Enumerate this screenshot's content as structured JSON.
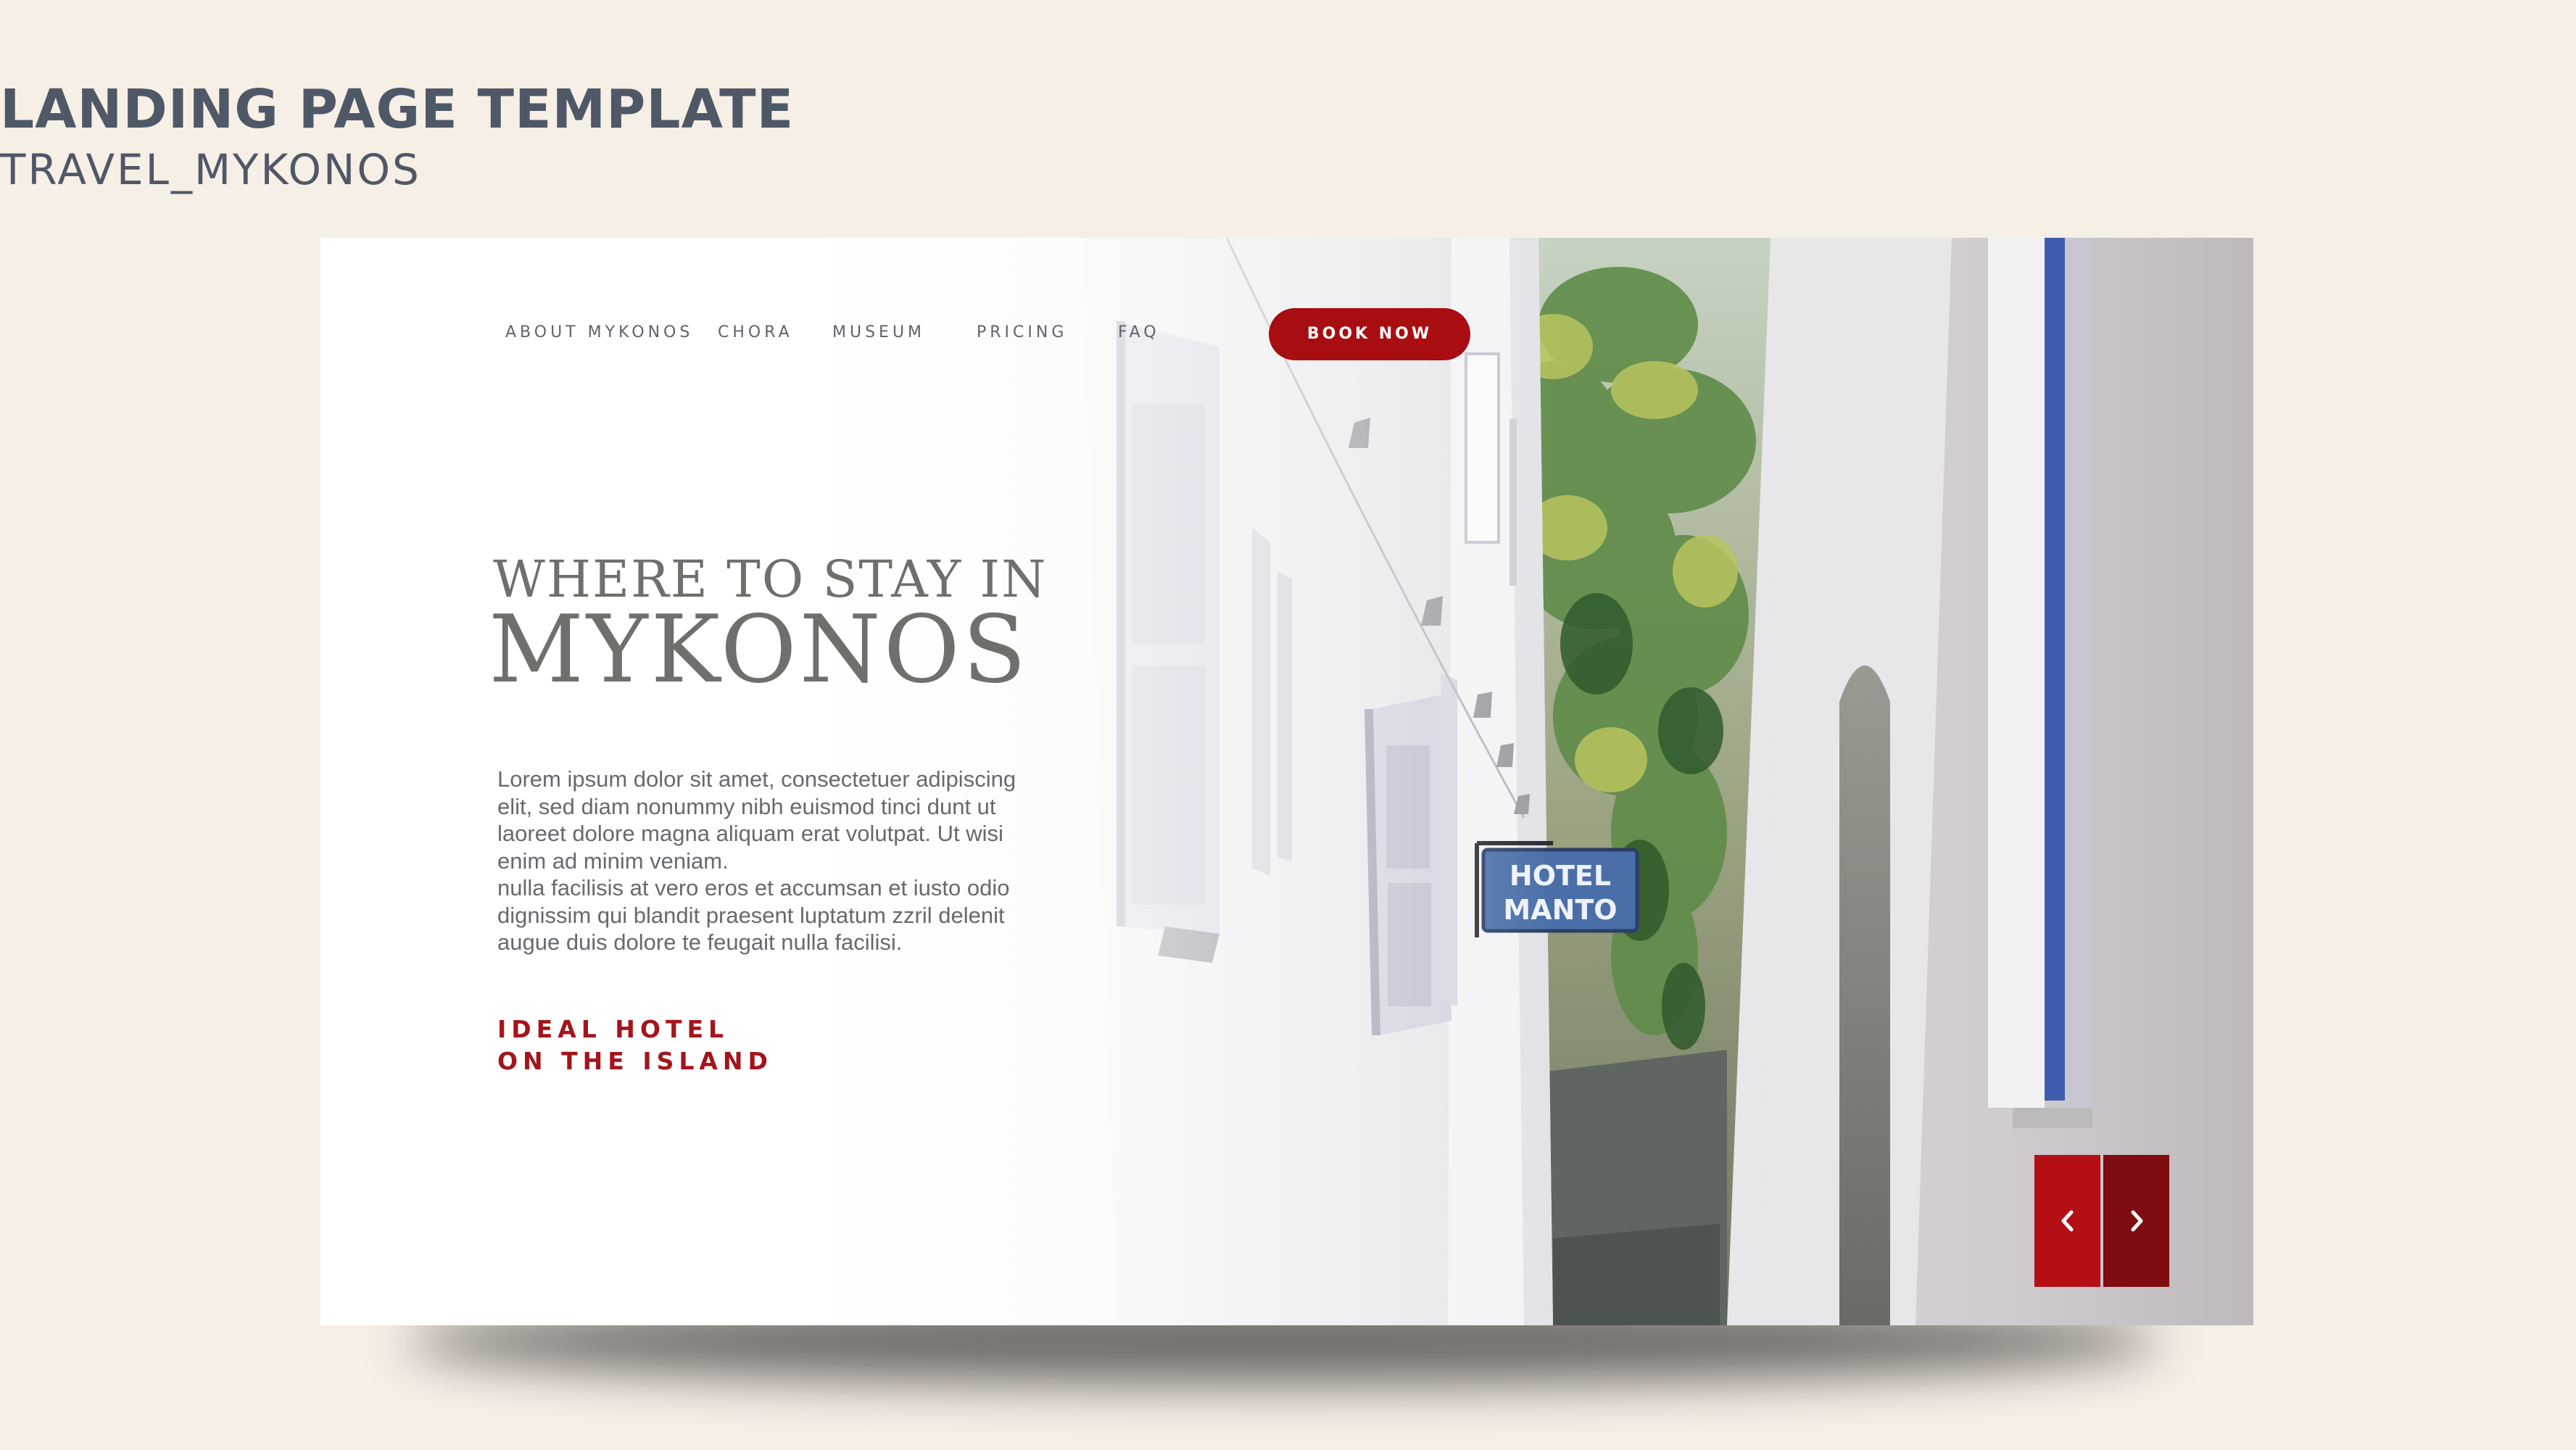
{
  "header": {
    "title": "LANDING PAGE TEMPLATE",
    "subtitle": "TRAVEL_MYKONOS"
  },
  "nav": {
    "items": [
      {
        "label": "ABOUT MYKONOS"
      },
      {
        "label": "CHORA"
      },
      {
        "label": "MUSEUM"
      },
      {
        "label": "PRICING"
      },
      {
        "label": "FAQ"
      }
    ],
    "cta_label": "BOOK NOW"
  },
  "hero": {
    "kicker": "WHERE TO STAY IN",
    "title": "MYKONOS",
    "body": [
      "Lorem ipsum dolor sit amet, consectetuer adipiscing",
      "elit, sed diam nonummy nibh euismod tinci dunt ut",
      "laoreet dolore magna aliquam erat volutpat. Ut wisi",
      "enim ad minim veniam.",
      "nulla facilisis at vero eros et accumsan et iusto odio",
      "dignissim qui blandit praesent luptatum zzril delenit",
      "augue duis dolore te feugait nulla facilisi."
    ],
    "tagline_line1": "IDEAL HOTEL",
    "tagline_line2": "ON THE ISLAND"
  },
  "scene": {
    "sign_line1": "HOTEL",
    "sign_line2": "MANTO"
  },
  "slider": {
    "prev_icon": "chevron-left-icon",
    "next_icon": "chevron-right-icon"
  },
  "colors": {
    "background": "#f6efe6",
    "heading": "#4f5866",
    "accent_red": "#a80d12",
    "accent_dark_red": "#7e0c10",
    "sign_blue": "#4a6fa8"
  }
}
